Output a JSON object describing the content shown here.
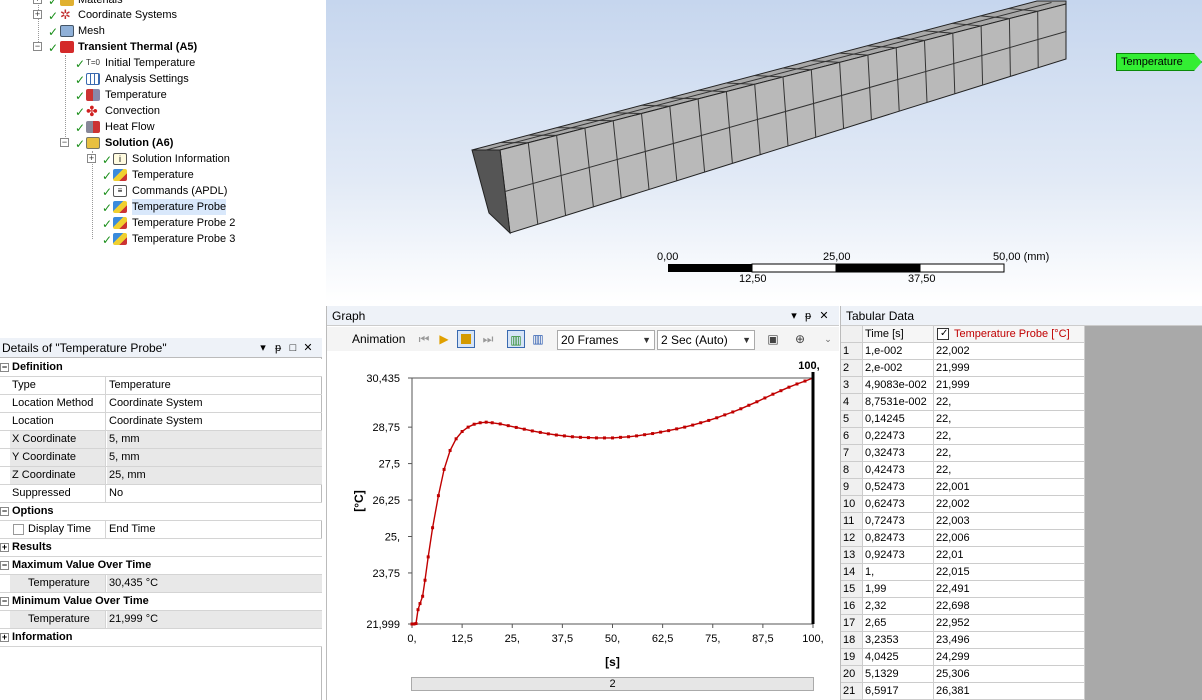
{
  "tree": {
    "items": [
      {
        "label": "Materials",
        "bold": false
      },
      {
        "label": "Coordinate Systems",
        "bold": false
      },
      {
        "label": "Mesh",
        "bold": false
      },
      {
        "label": "Transient Thermal (A5)",
        "bold": true
      },
      {
        "label": "Initial Temperature",
        "bold": false
      },
      {
        "label": "Analysis Settings",
        "bold": false
      },
      {
        "label": "Temperature",
        "bold": false
      },
      {
        "label": "Convection",
        "bold": false
      },
      {
        "label": "Heat Flow",
        "bold": false
      },
      {
        "label": "Solution (A6)",
        "bold": true
      },
      {
        "label": "Solution Information",
        "bold": false
      },
      {
        "label": "Temperature",
        "bold": false
      },
      {
        "label": "Commands (APDL)",
        "bold": false
      },
      {
        "label": "Temperature Probe",
        "bold": false
      },
      {
        "label": "Temperature Probe 2",
        "bold": false
      },
      {
        "label": "Temperature Probe 3",
        "bold": false
      }
    ]
  },
  "viewport": {
    "probe_label": "Temperature Probe",
    "scale_top": [
      "0,00",
      "25,00",
      "50,00 (mm)"
    ],
    "scale_bottom": [
      "12,50",
      "37,50"
    ]
  },
  "details": {
    "title": "Details of \"Temperature Probe\"",
    "header_buttons": [
      "▾",
      "ᵽ",
      "□",
      "✕"
    ],
    "rows": [
      {
        "type": "section",
        "label": "Definition",
        "toggle": "−"
      },
      {
        "type": "kv",
        "key": "Type",
        "value": "Temperature"
      },
      {
        "type": "kv",
        "key": "Location Method",
        "value": "Coordinate System"
      },
      {
        "type": "kv",
        "key": "Location",
        "value": "Coordinate System"
      },
      {
        "type": "kv",
        "key": "X Coordinate",
        "value": "5, mm",
        "gray": true
      },
      {
        "type": "kv",
        "key": "Y Coordinate",
        "value": "5, mm",
        "gray": true
      },
      {
        "type": "kv",
        "key": "Z Coordinate",
        "value": "25, mm",
        "gray": true
      },
      {
        "type": "kv",
        "key": "Suppressed",
        "value": "No"
      },
      {
        "type": "section",
        "label": "Options",
        "toggle": "−"
      },
      {
        "type": "kvcb",
        "key": "Display Time",
        "value": "End Time"
      },
      {
        "type": "section",
        "label": "Results",
        "toggle": "+"
      },
      {
        "type": "section",
        "label": "Maximum Value Over Time",
        "toggle": "−"
      },
      {
        "type": "kvcb",
        "key": "Temperature",
        "value": "30,435 °C",
        "gray": true
      },
      {
        "type": "section",
        "label": "Minimum Value Over Time",
        "toggle": "−"
      },
      {
        "type": "kvcb",
        "key": "Temperature",
        "value": "21,999 °C",
        "gray": true
      },
      {
        "type": "section",
        "label": "Information",
        "toggle": "+"
      }
    ]
  },
  "graph": {
    "title": "Graph",
    "animation_label": "Animation",
    "frames": "20 Frames",
    "duration": "2 Sec (Auto)",
    "time_slider_value": "2",
    "xlabel": "[s]",
    "ylabel": "[°C]",
    "y_ticks": [
      "30,435",
      "28,75",
      "27,5",
      "26,25",
      "25,",
      "23,75",
      "21,999"
    ],
    "x_ticks": [
      "0,",
      "12,5",
      "25,",
      "37,5",
      "50,",
      "62,5",
      "75,",
      "87,5",
      "100,"
    ],
    "marker_label": "100,"
  },
  "chart_data": {
    "type": "line",
    "xlabel": "[s]",
    "ylabel": "[°C]",
    "xlim": [
      0,
      100
    ],
    "ylim": [
      21.999,
      30.435
    ],
    "series": [
      {
        "name": "Temperature Probe [°C]",
        "color": "#c00000",
        "x": [
          0,
          0.5,
          1,
          1.5,
          2,
          2.65,
          3.25,
          4.04,
          5.13,
          6.59,
          8,
          9.5,
          11,
          12.5,
          14,
          15.5,
          17,
          18.5,
          20,
          22,
          24,
          26,
          28,
          30,
          32,
          34,
          36,
          38,
          40,
          42,
          44,
          46,
          48,
          50,
          52,
          54,
          56,
          58,
          60,
          62,
          64,
          66,
          68,
          70,
          72,
          74,
          76,
          78,
          80,
          82,
          84,
          86,
          88,
          90,
          92,
          94,
          96,
          98,
          100
        ],
        "y": [
          21.999,
          22.0,
          22.015,
          22.49,
          22.7,
          22.95,
          23.5,
          24.3,
          25.3,
          26.4,
          27.3,
          27.95,
          28.35,
          28.6,
          28.75,
          28.85,
          28.9,
          28.92,
          28.9,
          28.86,
          28.8,
          28.74,
          28.68,
          28.62,
          28.57,
          28.52,
          28.48,
          28.45,
          28.42,
          28.4,
          28.39,
          28.38,
          28.38,
          28.38,
          28.4,
          28.42,
          28.45,
          28.49,
          28.53,
          28.58,
          28.63,
          28.69,
          28.75,
          28.82,
          28.9,
          28.98,
          29.07,
          29.17,
          29.27,
          29.38,
          29.5,
          29.62,
          29.75,
          29.88,
          30.0,
          30.12,
          30.23,
          30.33,
          30.435
        ]
      }
    ]
  },
  "tabular": {
    "title": "Tabular Data",
    "header_idx": "",
    "header_time": "Time [s]",
    "header_temp": "Temperature Probe [°C]",
    "rows": [
      [
        "1",
        "1,e-002",
        "22,002"
      ],
      [
        "2",
        "2,e-002",
        "21,999"
      ],
      [
        "3",
        "4,9083e-002",
        "21,999"
      ],
      [
        "4",
        "8,7531e-002",
        "22,"
      ],
      [
        "5",
        "0,14245",
        "22,"
      ],
      [
        "6",
        "0,22473",
        "22,"
      ],
      [
        "7",
        "0,32473",
        "22,"
      ],
      [
        "8",
        "0,42473",
        "22,"
      ],
      [
        "9",
        "0,52473",
        "22,001"
      ],
      [
        "10",
        "0,62473",
        "22,002"
      ],
      [
        "11",
        "0,72473",
        "22,003"
      ],
      [
        "12",
        "0,82473",
        "22,006"
      ],
      [
        "13",
        "0,92473",
        "22,01"
      ],
      [
        "14",
        "1,",
        "22,015"
      ],
      [
        "15",
        "1,99",
        "22,491"
      ],
      [
        "16",
        "2,32",
        "22,698"
      ],
      [
        "17",
        "2,65",
        "22,952"
      ],
      [
        "18",
        "3,2353",
        "23,496"
      ],
      [
        "19",
        "4,0425",
        "24,299"
      ],
      [
        "20",
        "5,1329",
        "25,306"
      ],
      [
        "21",
        "6,5917",
        "26,381"
      ]
    ]
  }
}
